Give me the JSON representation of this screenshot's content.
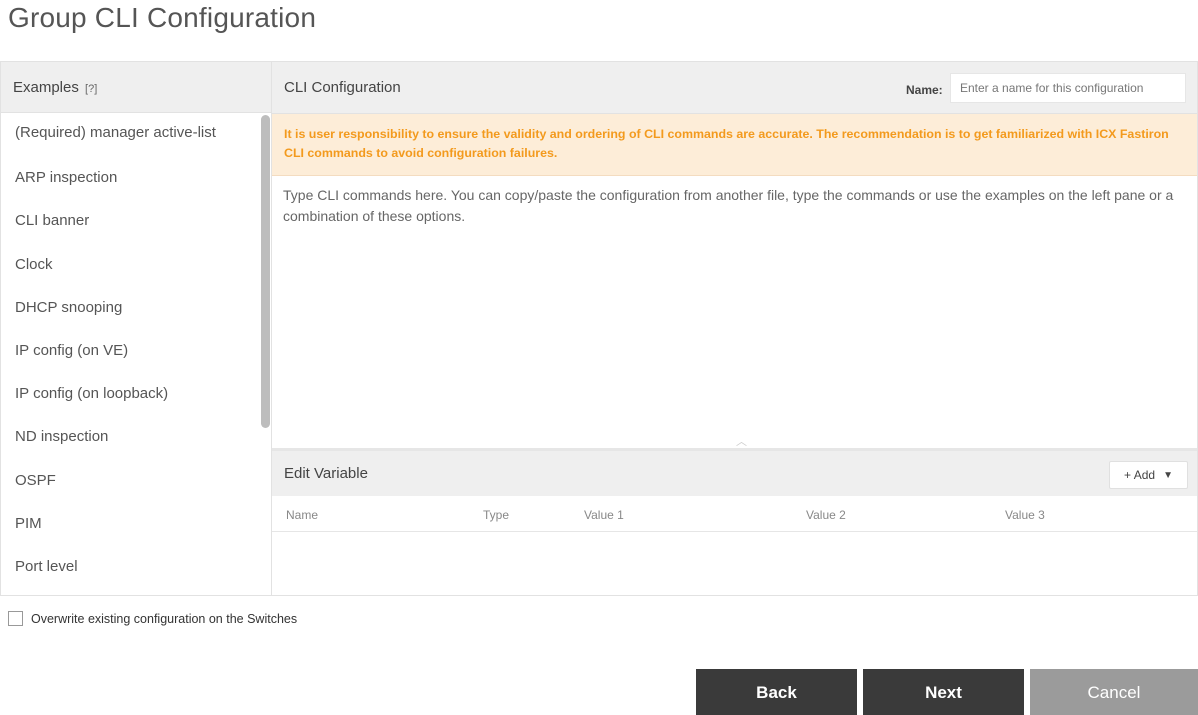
{
  "page": {
    "title": "Group CLI Configuration"
  },
  "examples": {
    "title": "Examples",
    "help": "[?]",
    "items": [
      "(Required) manager active-list",
      "ARP inspection",
      "CLI banner",
      "Clock",
      "DHCP snooping",
      "IP config (on VE)",
      "IP config (on loopback)",
      "ND inspection",
      "OSPF",
      "PIM",
      "Port level"
    ]
  },
  "cli": {
    "title": "CLI Configuration",
    "name_label": "Name:",
    "name_placeholder": "Enter a name for this configuration",
    "warning": "It is user responsibility to ensure the validity and ordering of CLI commands are accurate. The recommendation is to get familiarized with ICX Fastiron CLI commands to avoid configuration failures.",
    "text_placeholder": "Type CLI commands here. You can copy/paste the configuration from another file, type the commands or use the examples on the left pane or a combination of these options."
  },
  "edit_variable": {
    "title": "Edit Variable",
    "add_label": "+ Add",
    "columns": [
      "Name",
      "Type",
      "Value 1",
      "Value 2",
      "Value 3"
    ]
  },
  "overwrite": {
    "label": "Overwrite existing configuration on the Switches",
    "checked": false
  },
  "buttons": {
    "back": "Back",
    "next": "Next",
    "cancel": "Cancel"
  }
}
